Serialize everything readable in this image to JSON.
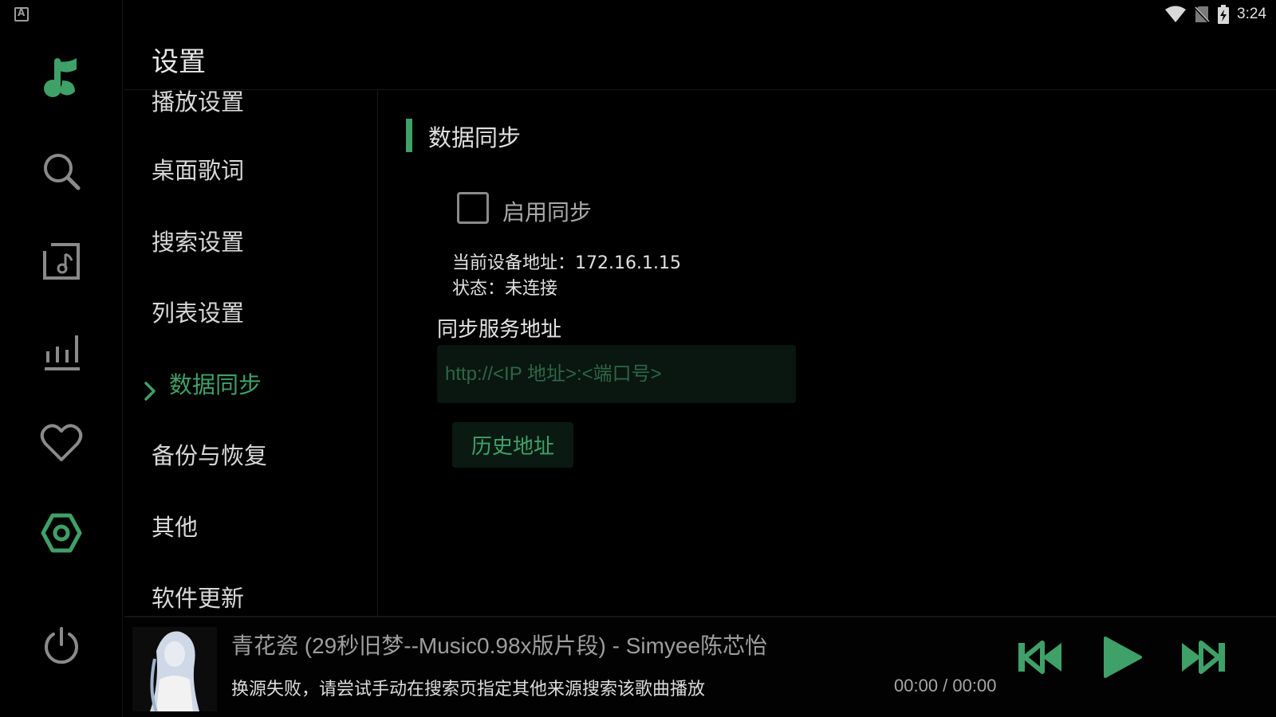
{
  "status_bar": {
    "time": "3:24"
  },
  "colors": {
    "accent": "#3fa068",
    "background": "#000000",
    "text": "#d8d8d8"
  },
  "rail": {
    "items": [
      {
        "icon": "music-note-logo-icon"
      },
      {
        "icon": "search-icon"
      },
      {
        "icon": "playlist-icon"
      },
      {
        "icon": "bar-chart-icon"
      },
      {
        "icon": "heart-icon"
      },
      {
        "icon": "settings-icon",
        "active": true
      },
      {
        "icon": "power-icon"
      }
    ]
  },
  "header": {
    "title": "设置"
  },
  "nav": {
    "items": [
      {
        "label": "播放设置"
      },
      {
        "label": "桌面歌词"
      },
      {
        "label": "搜索设置"
      },
      {
        "label": "列表设置"
      },
      {
        "label": "数据同步",
        "active": true
      },
      {
        "label": "备份与恢复"
      },
      {
        "label": "其他"
      },
      {
        "label": "软件更新"
      }
    ]
  },
  "sync": {
    "section_title": "数据同步",
    "enable_label": "启用同步",
    "enabled": false,
    "device_address": "当前设备地址：172.16.1.15",
    "status": "状态：未连接",
    "server_label": "同步服务地址",
    "server_value": "",
    "server_placeholder": "http://<IP 地址>:<端口号>",
    "history_button": "历史地址"
  },
  "player": {
    "title": "青花瓷 (29秒旧梦--Music0.98x版片段) - Simyee陈芯怡",
    "status": "换源失败，请尝试手动在搜索页指定其他来源搜索该歌曲播放",
    "time": "00:00 / 00:00"
  }
}
